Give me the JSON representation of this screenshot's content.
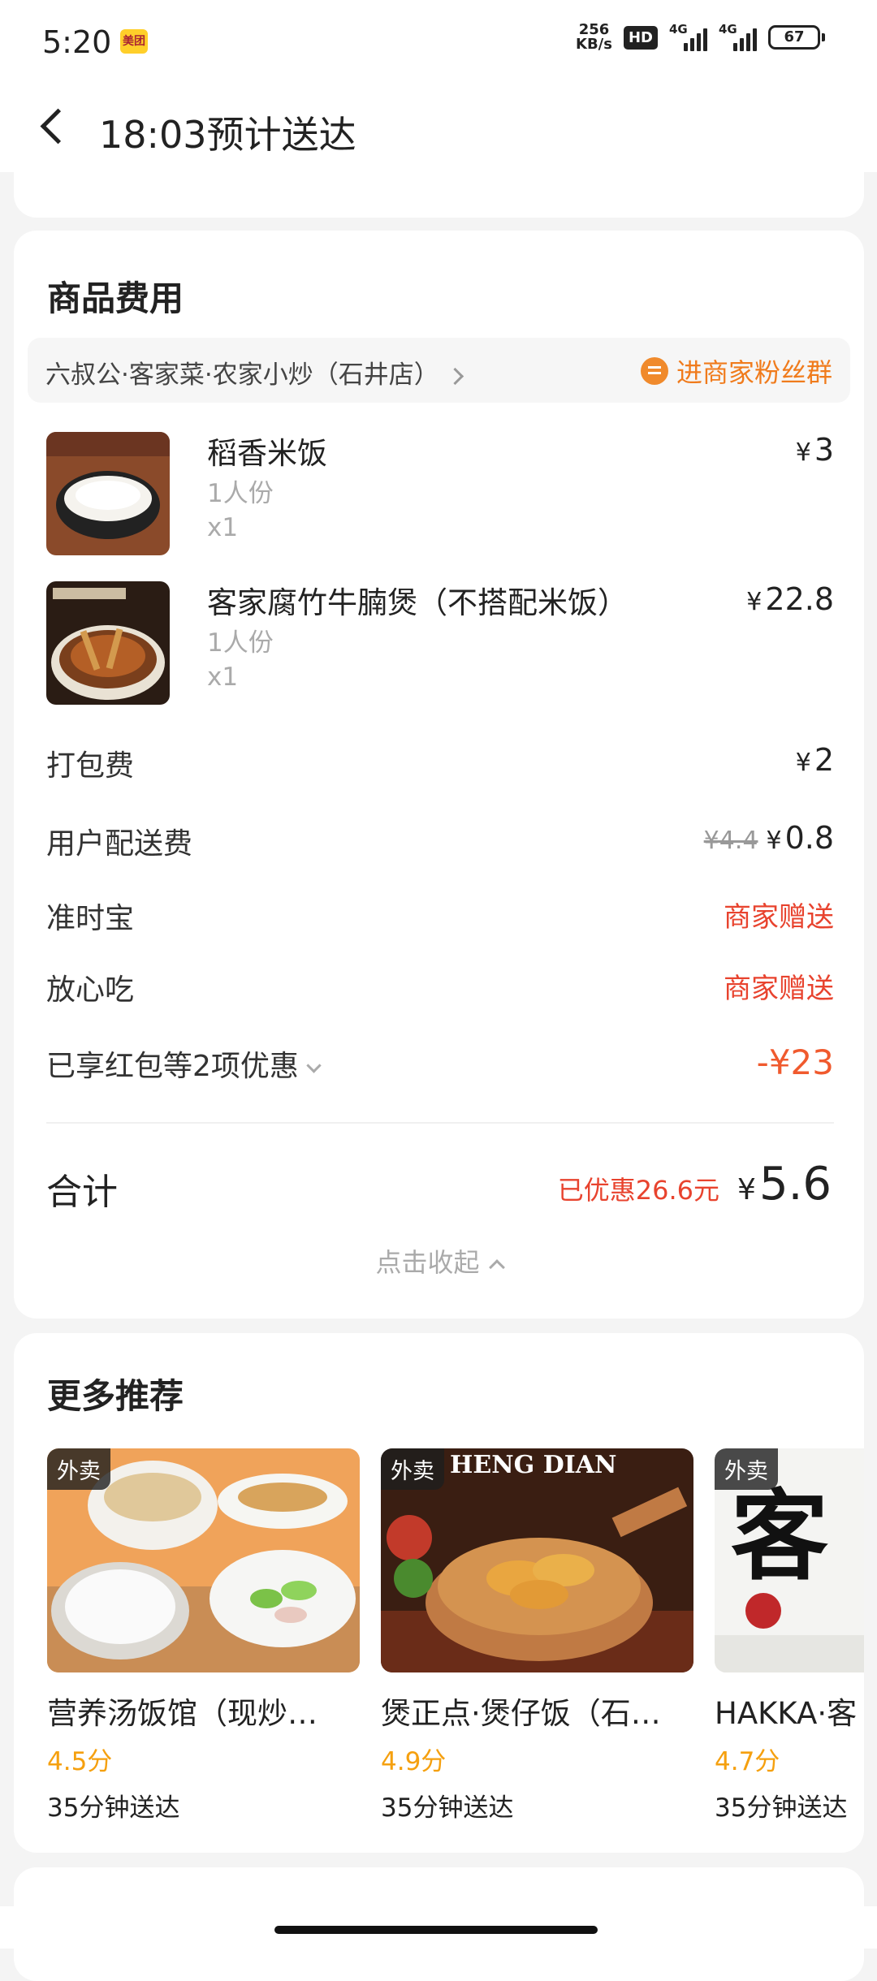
{
  "status_bar": {
    "time": "5:20",
    "app_badge": "美团",
    "speed_value": "256",
    "speed_unit": "KB/s",
    "hd": "HD",
    "sig1": "4G",
    "sig2": "4G",
    "battery": "67"
  },
  "header": {
    "title": "18:03预计送达"
  },
  "fees": {
    "section_title": "商品费用",
    "shop_name": "六叔公·客家菜·农家小炒（石井店）",
    "fan_group": "进商家粉丝群",
    "items": [
      {
        "name": "稻香米饭",
        "spec": "1人份",
        "qty": "x1",
        "price_symbol": "¥",
        "price": "3"
      },
      {
        "name": "客家腐竹牛腩煲（不搭配米饭）",
        "spec": "1人份",
        "qty": "x1",
        "price_symbol": "¥",
        "price": "22.8"
      }
    ],
    "packing": {
      "label": "打包费",
      "symbol": "¥",
      "value": "2"
    },
    "delivery": {
      "label": "用户配送费",
      "original": "¥4.4",
      "symbol": "¥",
      "value": "0.8"
    },
    "ontime": {
      "label": "准时宝",
      "value": "商家赠送"
    },
    "safe": {
      "label": "放心吃",
      "value": "商家赠送"
    },
    "discount": {
      "label": "已享红包等2项优惠",
      "value": "-¥23"
    },
    "total": {
      "label": "合计",
      "saved": "已优惠26.6元",
      "symbol": "¥",
      "value": "5.6"
    },
    "collapse": "点击收起"
  },
  "recommend": {
    "title": "更多推荐",
    "items": [
      {
        "tag": "外卖",
        "name": "营养汤饭馆（现炒…",
        "score": "4.5分",
        "eta": "35分钟送达"
      },
      {
        "tag": "外卖",
        "name": "煲正点·煲仔饭（石…",
        "score": "4.9分",
        "eta": "35分钟送达",
        "banner_text": "HENG DIAN"
      },
      {
        "tag": "外卖",
        "name": "HAKKA·客",
        "score": "4.7分",
        "eta": "35分钟送达",
        "banner_text": "客"
      }
    ]
  },
  "colors": {
    "accent_orange": "#f07b1c",
    "discount_red": "#e8432e",
    "score_yellow": "#f5a00f"
  }
}
